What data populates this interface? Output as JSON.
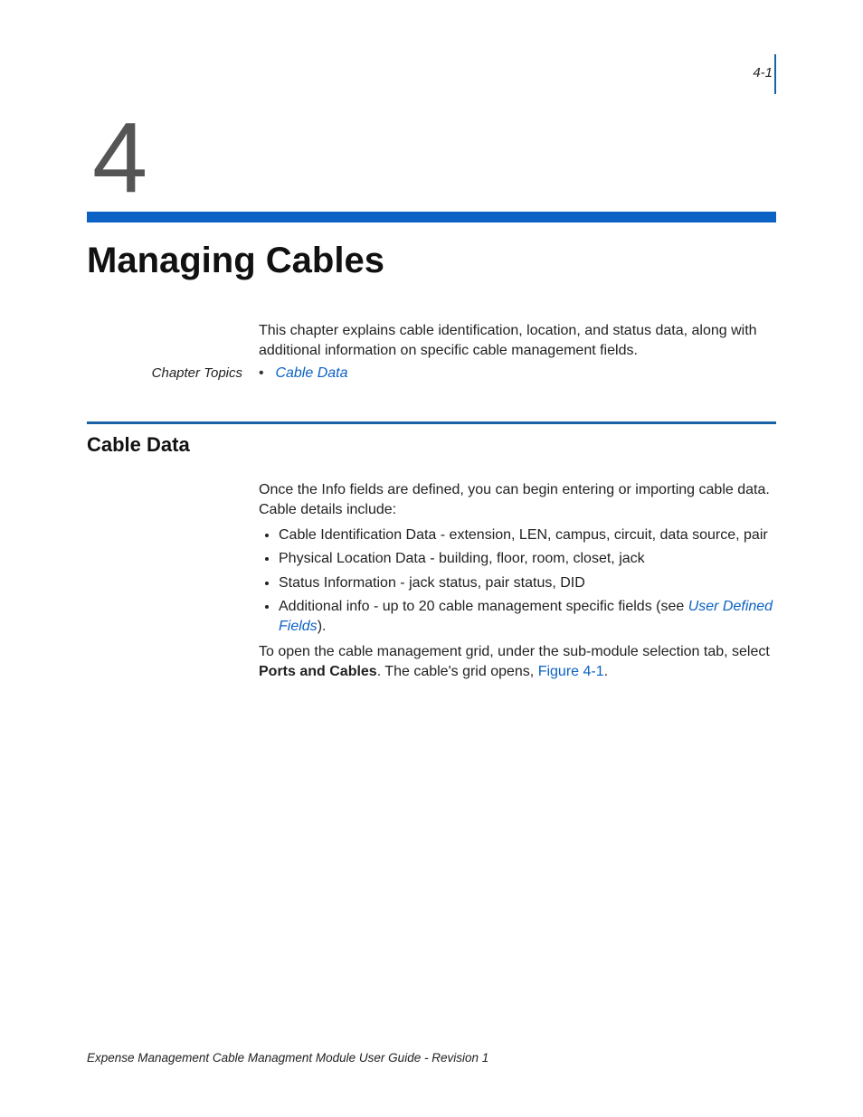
{
  "header": {
    "page_number": "4-1",
    "chapter_number": "4",
    "chapter_title": "Managing Cables"
  },
  "intro": "This chapter explains cable identification, location, and status data, along with additional information on specific cable management fields.",
  "chapter_topics": {
    "label": "Chapter Topics",
    "items": [
      "Cable Data"
    ]
  },
  "section": {
    "title": "Cable Data",
    "p1": "Once the Info fields are defined, you can begin entering or importing cable data. Cable details include:",
    "bullets": [
      "Cable Identification Data - extension, LEN, campus, circuit, data source, pair",
      "Physical Location Data - building, floor, room, closet, jack",
      "Status Information - jack status, pair status, DID"
    ],
    "bullet4_pre": "Additional info - up to 20 cable management specific fields (see ",
    "bullet4_link": "User Defined Fields",
    "bullet4_post": ").",
    "p2_pre": "To open the cable management grid, under the sub-module selection tab, select ",
    "p2_bold": "Ports and Cables",
    "p2_mid": ". The cable's grid opens, ",
    "p2_link": "Figure 4-1",
    "p2_post": "."
  },
  "footer": "Expense Management Cable Managment Module User Guide - Revision 1"
}
